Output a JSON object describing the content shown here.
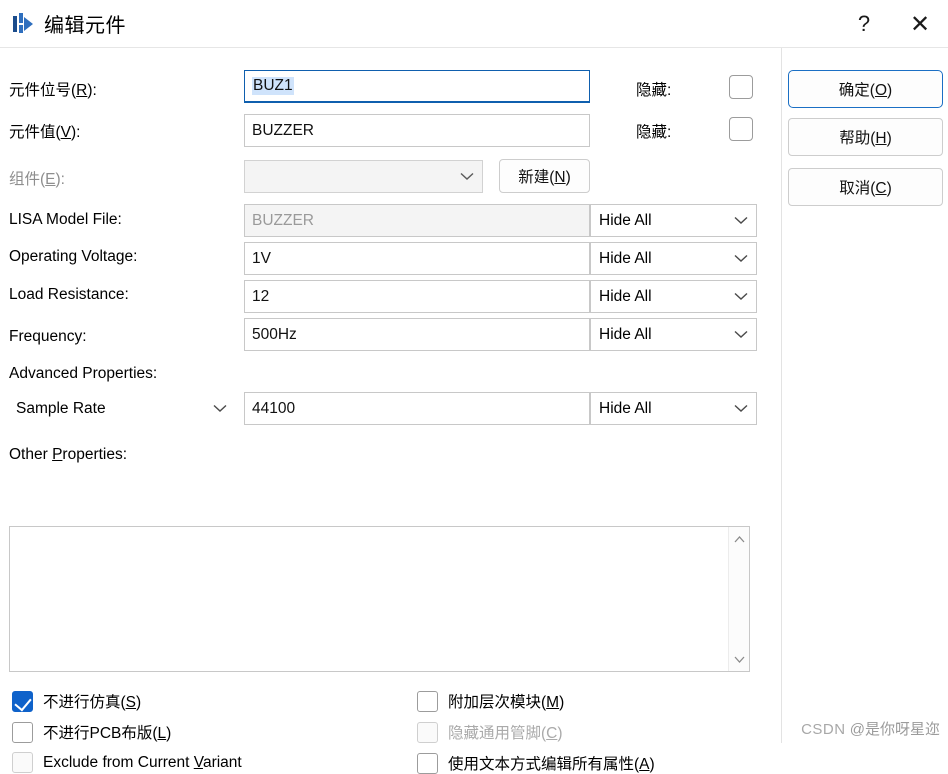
{
  "window": {
    "title": "编辑元件",
    "icon": "schematic-component-icon",
    "help_glyph": "?",
    "close_glyph": "✕"
  },
  "fields": {
    "reference": {
      "label_prefix": "元件位号(",
      "label_accel": "R",
      "label_suffix": "):",
      "value": "BUZ1",
      "selected": true,
      "hidden_label": "隐藏:",
      "hidden_checked": false
    },
    "value": {
      "label_prefix": "元件值(",
      "label_accel": "V",
      "label_suffix": "):",
      "value": "BUZZER",
      "hidden_label": "隐藏:",
      "hidden_checked": false
    },
    "element": {
      "label_prefix": "组件(",
      "label_accel": "E",
      "label_suffix": "):",
      "value": "",
      "new_button_prefix": "新建(",
      "new_button_accel": "N",
      "new_button_suffix": ")"
    }
  },
  "properties": [
    {
      "label": "LISA Model File:",
      "value": "BUZZER",
      "readonly": true,
      "visibility": "Hide All"
    },
    {
      "label": "Operating Voltage:",
      "value": "1V",
      "readonly": false,
      "visibility": "Hide All"
    },
    {
      "label": "Load Resistance:",
      "value": "12",
      "readonly": false,
      "visibility": "Hide All"
    },
    {
      "label": "Frequency:",
      "value": "500Hz",
      "readonly": false,
      "visibility": "Hide All"
    }
  ],
  "advanced": {
    "label": "Advanced Properties:",
    "selector_value": "Sample Rate",
    "value": "44100",
    "visibility": "Hide All"
  },
  "other_properties": {
    "label_prefix": "Other ",
    "label_accel": "P",
    "label_suffix": "roperties:",
    "value": ""
  },
  "checkboxes": [
    {
      "name": "exclude-from-simulation",
      "text_prefix": "不进行仿真(",
      "accel": "S",
      "text_suffix": ")",
      "checked": true,
      "disabled": false,
      "col": "left"
    },
    {
      "name": "exclude-from-pcb-layout",
      "text_prefix": "不进行PCB布版(",
      "accel": "L",
      "text_suffix": ")",
      "checked": false,
      "disabled": false,
      "col": "left"
    },
    {
      "name": "exclude-from-current-variant",
      "text_prefix": "Exclude from Current ",
      "accel": "V",
      "text_suffix": "ariant",
      "checked": false,
      "disabled": true,
      "col": "left"
    },
    {
      "name": "attach-hierarchy-module",
      "text_prefix": "附加层次模块(",
      "accel": "M",
      "text_suffix": ")",
      "checked": false,
      "disabled": false,
      "col": "right"
    },
    {
      "name": "hide-common-pins",
      "text_prefix": "隐藏通用管脚(",
      "accel": "C",
      "text_suffix": ")",
      "checked": false,
      "disabled": true,
      "col": "right"
    },
    {
      "name": "edit-all-properties-as-text",
      "text_prefix": "使用文本方式编辑所有属性(",
      "accel": "A",
      "text_suffix": ")",
      "checked": false,
      "disabled": false,
      "col": "right"
    }
  ],
  "buttons": {
    "ok": {
      "prefix": "确定(",
      "accel": "O",
      "suffix": ")"
    },
    "help": {
      "prefix": "帮助(",
      "accel": "H",
      "suffix": ")"
    },
    "cancel": {
      "prefix": "取消(",
      "accel": "C",
      "suffix": ")"
    }
  },
  "watermark": {
    "brand": "CSDN",
    "text": "@是你呀星迩"
  }
}
